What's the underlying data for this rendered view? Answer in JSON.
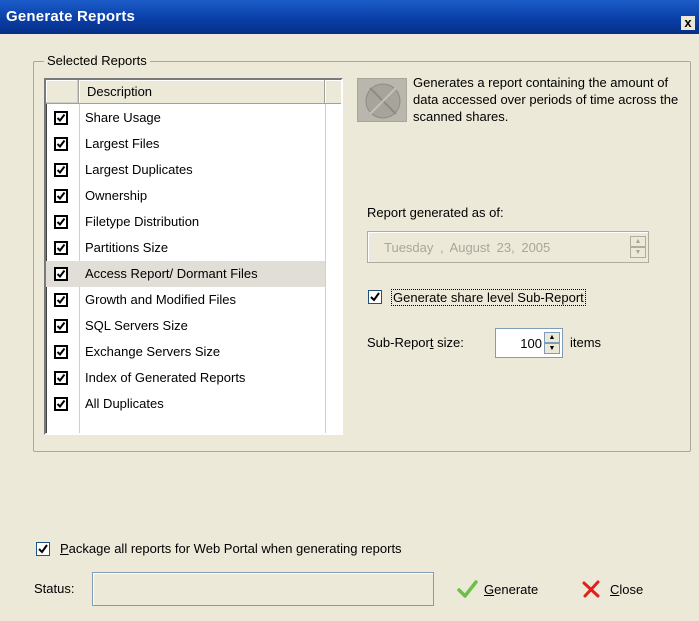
{
  "window": {
    "title": "Generate Reports",
    "close_glyph": "x"
  },
  "group": {
    "legend": "Selected Reports"
  },
  "list": {
    "header": "Description",
    "items": [
      {
        "label": "Share Usage",
        "checked": true
      },
      {
        "label": "Largest Files",
        "checked": true
      },
      {
        "label": "Largest Duplicates",
        "checked": true
      },
      {
        "label": "Ownership",
        "checked": true
      },
      {
        "label": "Filetype Distribution",
        "checked": true
      },
      {
        "label": "Partitions Size",
        "checked": true
      },
      {
        "label": "Access Report/ Dormant Files",
        "checked": true,
        "selected": true
      },
      {
        "label": "Growth and Modified Files",
        "checked": true
      },
      {
        "label": "SQL Servers Size",
        "checked": true
      },
      {
        "label": "Exchange Servers Size",
        "checked": true
      },
      {
        "label": "Index of Generated Reports",
        "checked": true
      },
      {
        "label": "All Duplicates",
        "checked": true
      }
    ]
  },
  "description": {
    "icon": "report-image-icon",
    "text": "Generates a report containing the amount of data accessed over periods of time across the scanned shares."
  },
  "report_date": {
    "label": "Report generated as of:",
    "weekday": "Tuesday",
    "sep": ",",
    "month": "August",
    "day_year": "23, 2005"
  },
  "subreport": {
    "checkbox_label": "Generate share level Sub-Report",
    "checked": true,
    "size_label_pre": "Sub-Repor",
    "size_label_ul": "t",
    "size_label_post": " size:",
    "size_value": "100",
    "items_label": "items"
  },
  "package": {
    "label_ul": "P",
    "label_rest": "ackage all reports for Web Portal when generating reports",
    "checked": true
  },
  "status": {
    "label": "Status:",
    "value": ""
  },
  "buttons": {
    "generate_ul": "G",
    "generate_rest": "enerate",
    "close_ul": "C",
    "close_rest": "lose"
  },
  "colors": {
    "titlebar": "#0a3fa8",
    "dialog_bg": "#ece9d8",
    "generate_check": "#6cc04a",
    "close_x": "#e0201c"
  }
}
